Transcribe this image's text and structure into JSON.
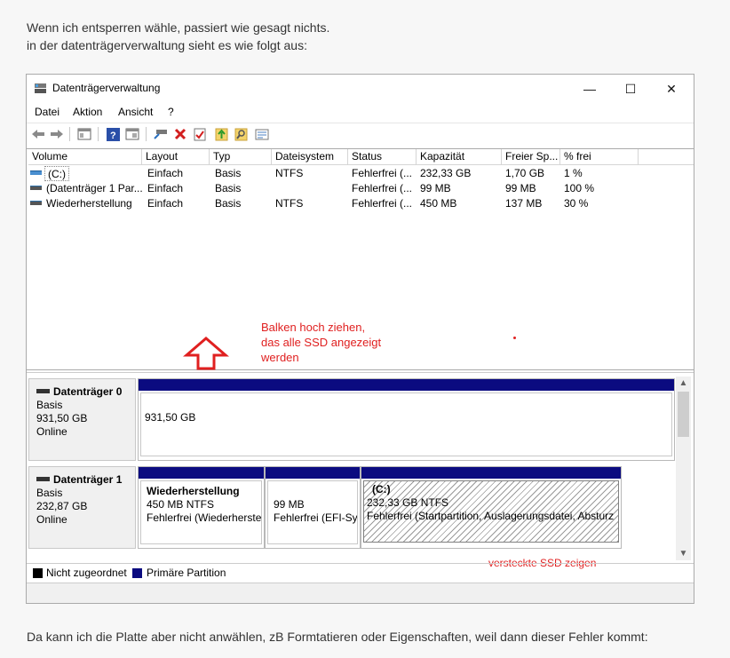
{
  "post": {
    "intro_line1": "Wenn ich entsperren wähle, passiert wie gesagt nichts.",
    "intro_line2": "in der datenträgerverwaltung sieht es wie folgt aus:",
    "outro": "Da kann ich die Platte aber nicht anwählen, zB Formtatieren oder Eigenschaften, weil dann dieser Fehler kommt:"
  },
  "window": {
    "title": "Datenträgerverwaltung",
    "controls": {
      "minimize": "—",
      "maximize": "☐",
      "close": "✕"
    }
  },
  "menu": [
    "Datei",
    "Aktion",
    "Ansicht",
    "?"
  ],
  "toolbar": {
    "icons": [
      "back-arrow-icon",
      "forward-arrow-icon",
      "properties-pane-icon",
      "help-icon",
      "view-icon",
      "connect-drive-icon",
      "delete-icon",
      "checklist-icon",
      "export-icon",
      "search-disk-icon",
      "settings-pane-icon"
    ]
  },
  "volume_list": {
    "columns": [
      "Volume",
      "Layout",
      "Typ",
      "Dateisystem",
      "Status",
      "Kapazität",
      "Freier Sp...",
      "% frei"
    ],
    "rows": [
      {
        "volume": "(C:)",
        "layout": "Einfach",
        "typ": "Basis",
        "dateisystem": "NTFS",
        "status": "Fehlerfrei (...",
        "kapazitaet": "232,33 GB",
        "frei": "1,70 GB",
        "prozent": "1 %"
      },
      {
        "volume": "(Datenträger 1 Par...",
        "layout": "Einfach",
        "typ": "Basis",
        "dateisystem": "",
        "status": "Fehlerfrei (...",
        "kapazitaet": "99 MB",
        "frei": "99 MB",
        "prozent": "100 %"
      },
      {
        "volume": "Wiederherstellung",
        "layout": "Einfach",
        "typ": "Basis",
        "dateisystem": "NTFS",
        "status": "Fehlerfrei (...",
        "kapazitaet": "450 MB",
        "frei": "137 MB",
        "prozent": "30 %"
      }
    ]
  },
  "annotations": {
    "drag_hint_line1": "Balken hoch ziehen,",
    "drag_hint_line2": "das alle SSD angezeigt",
    "drag_hint_line3": "werden",
    "hidden_ssd": "versteckte SSD zeigen",
    "color": "#e02020"
  },
  "disks": [
    {
      "name": "Datenträger 0",
      "type": "Basis",
      "size": "931,50 GB",
      "state": "Online",
      "partitions": [
        {
          "line1": "",
          "line2": "931,50 GB",
          "line3": ""
        }
      ]
    },
    {
      "name": "Datenträger 1",
      "type": "Basis",
      "size": "232,87 GB",
      "state": "Online",
      "partitions": [
        {
          "line1": "Wiederherstellung",
          "line2": "450 MB NTFS",
          "line3": "Fehlerfrei (Wiederherstel"
        },
        {
          "line1": "",
          "line2": "99 MB",
          "line3": "Fehlerfrei (EFI-Sys"
        },
        {
          "line1": "(C:)",
          "line2": "232,33 GB NTFS",
          "line3": "Fehlerfrei (Startpartition, Auslagerungsdatei, Absturz"
        }
      ]
    }
  ],
  "legend": {
    "unallocated": "Nicht zugeordnet",
    "primary": "Primäre Partition",
    "unallocated_color": "#000000",
    "primary_color": "#0b0b80"
  }
}
